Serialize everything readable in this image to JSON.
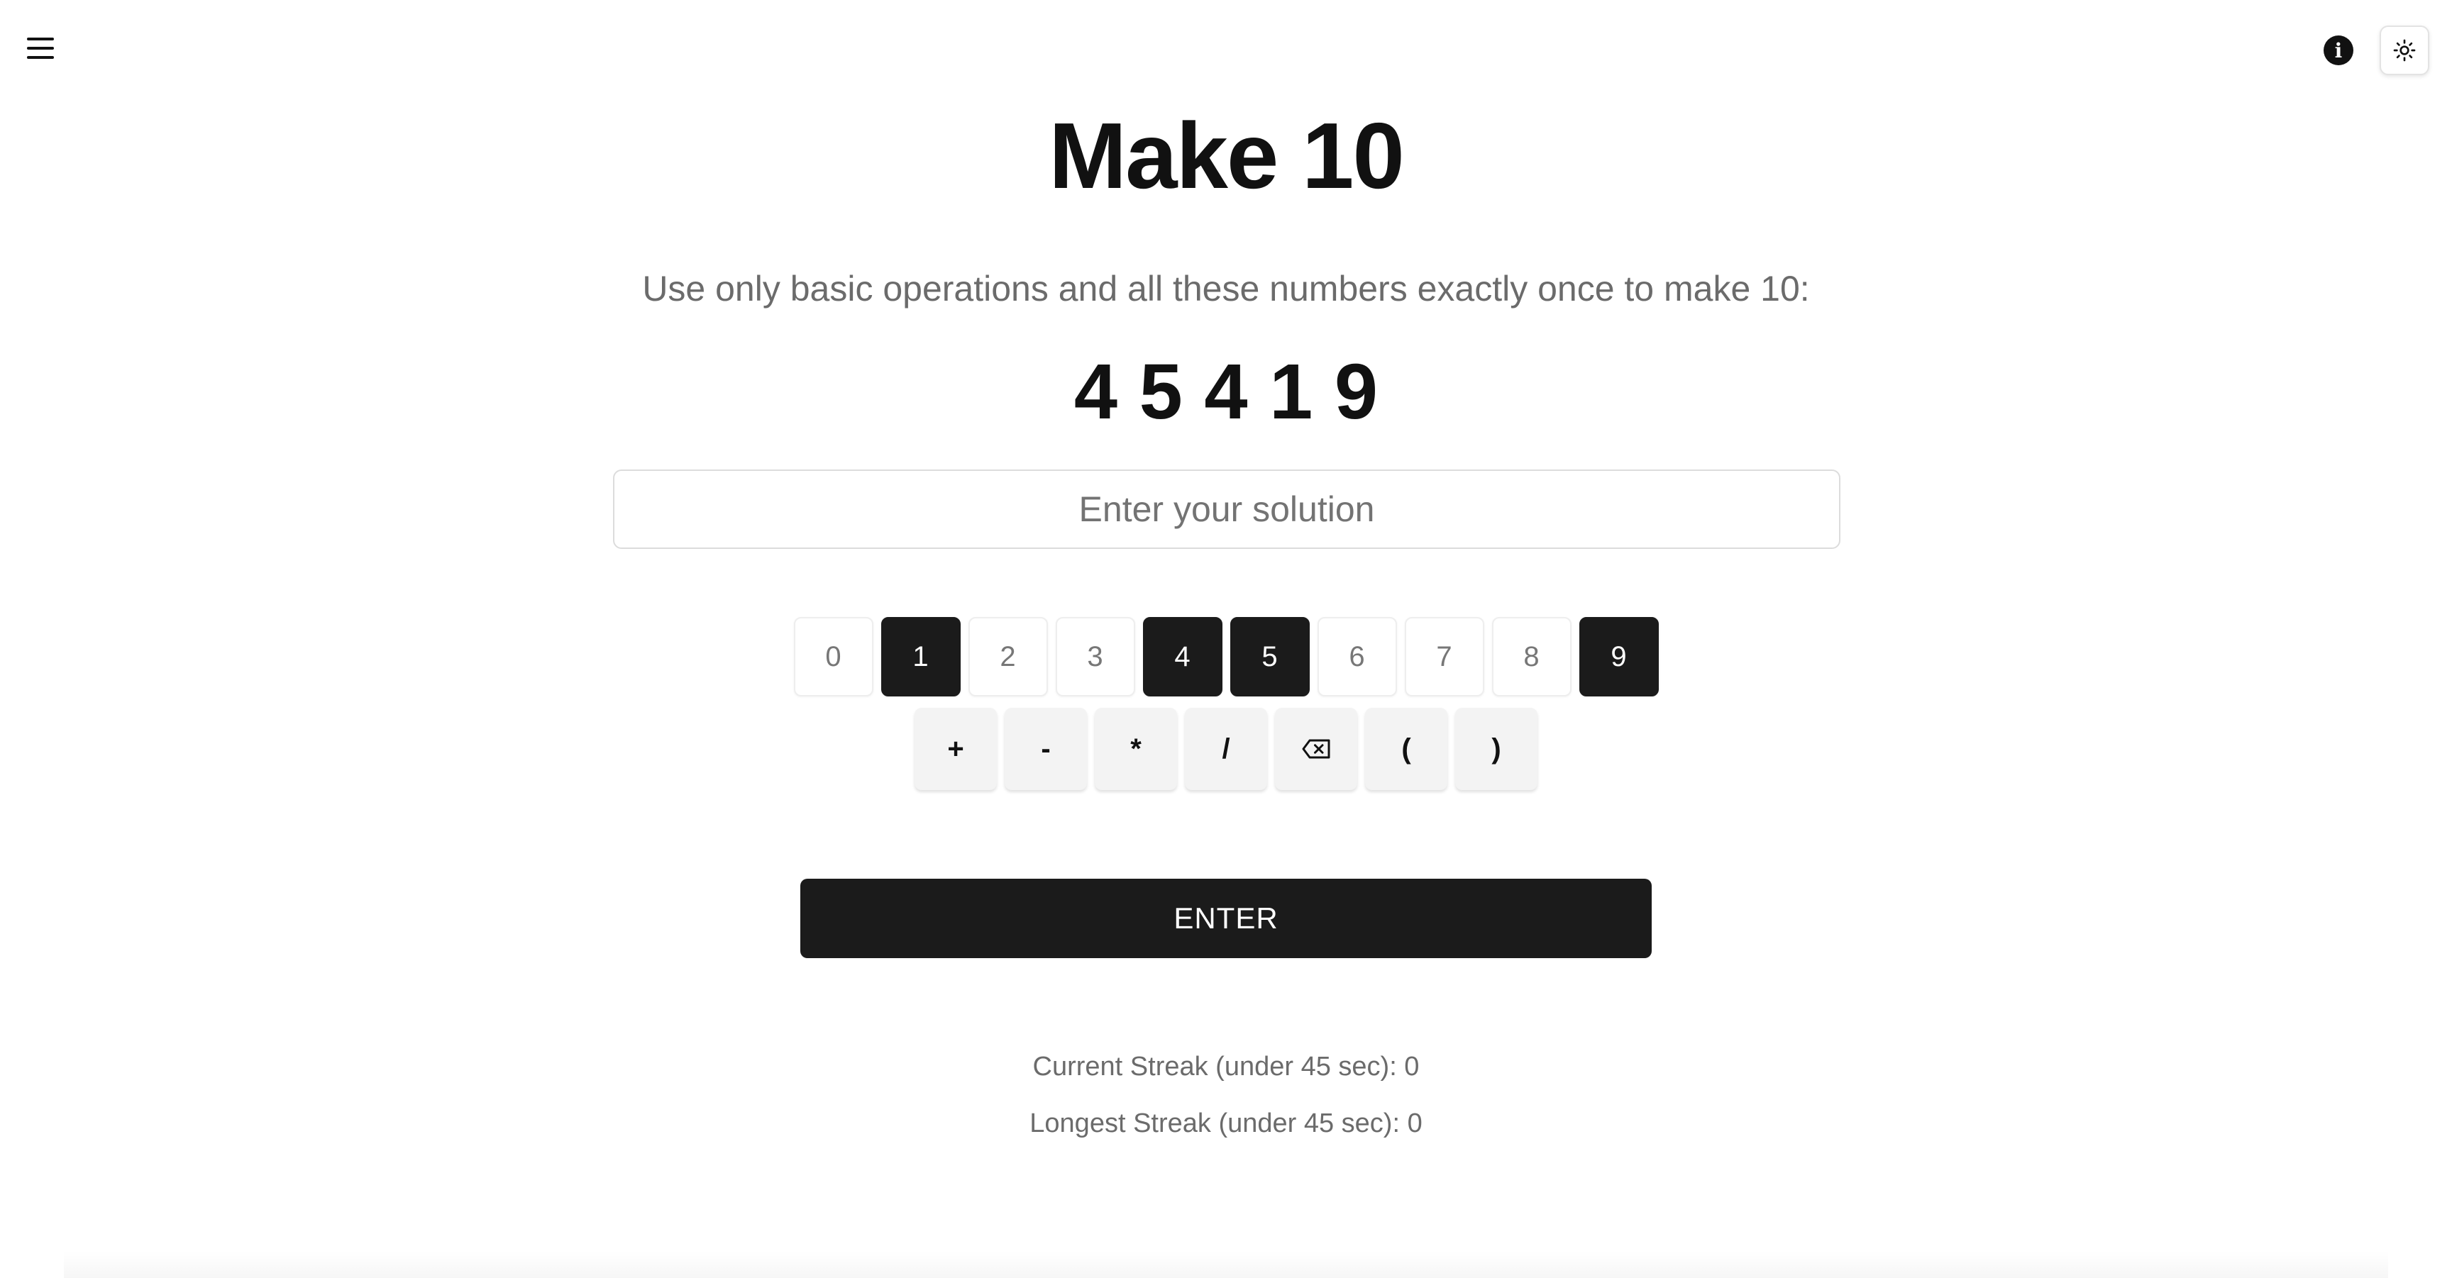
{
  "header": {
    "menu_icon": "hamburger-menu-icon",
    "info_icon": "info-icon",
    "theme_icon": "sun-icon"
  },
  "main": {
    "title": "Make 10",
    "instructions": "Use only basic operations and all these numbers exactly once to make 10:",
    "numbers": "4 5 4 1 9",
    "solution": {
      "value": "",
      "placeholder": "Enter your solution"
    }
  },
  "keypad": {
    "digits": [
      {
        "label": "0",
        "active": false
      },
      {
        "label": "1",
        "active": true
      },
      {
        "label": "2",
        "active": false
      },
      {
        "label": "3",
        "active": false
      },
      {
        "label": "4",
        "active": true
      },
      {
        "label": "5",
        "active": true
      },
      {
        "label": "6",
        "active": false
      },
      {
        "label": "7",
        "active": false
      },
      {
        "label": "8",
        "active": false
      },
      {
        "label": "9",
        "active": true
      }
    ],
    "operators": [
      {
        "label": "+",
        "name": "plus-key"
      },
      {
        "label": "-",
        "name": "minus-key"
      },
      {
        "label": "*",
        "name": "multiply-key"
      },
      {
        "label": "/",
        "name": "divide-key"
      },
      {
        "label": "",
        "name": "backspace-key",
        "icon": "backspace-icon"
      },
      {
        "label": "(",
        "name": "open-paren-key"
      },
      {
        "label": ")",
        "name": "close-paren-key"
      }
    ],
    "enter_label": "ENTER"
  },
  "stats": {
    "current_streak": "Current Streak (under 45 sec): 0",
    "longest_streak": "Longest Streak (under 45 sec): 0"
  },
  "colors": {
    "active_key": "#1b1b1b",
    "inactive_key_text": "#777777",
    "operator_bg": "#f3f3f3",
    "muted_text": "#6b6b6b"
  }
}
